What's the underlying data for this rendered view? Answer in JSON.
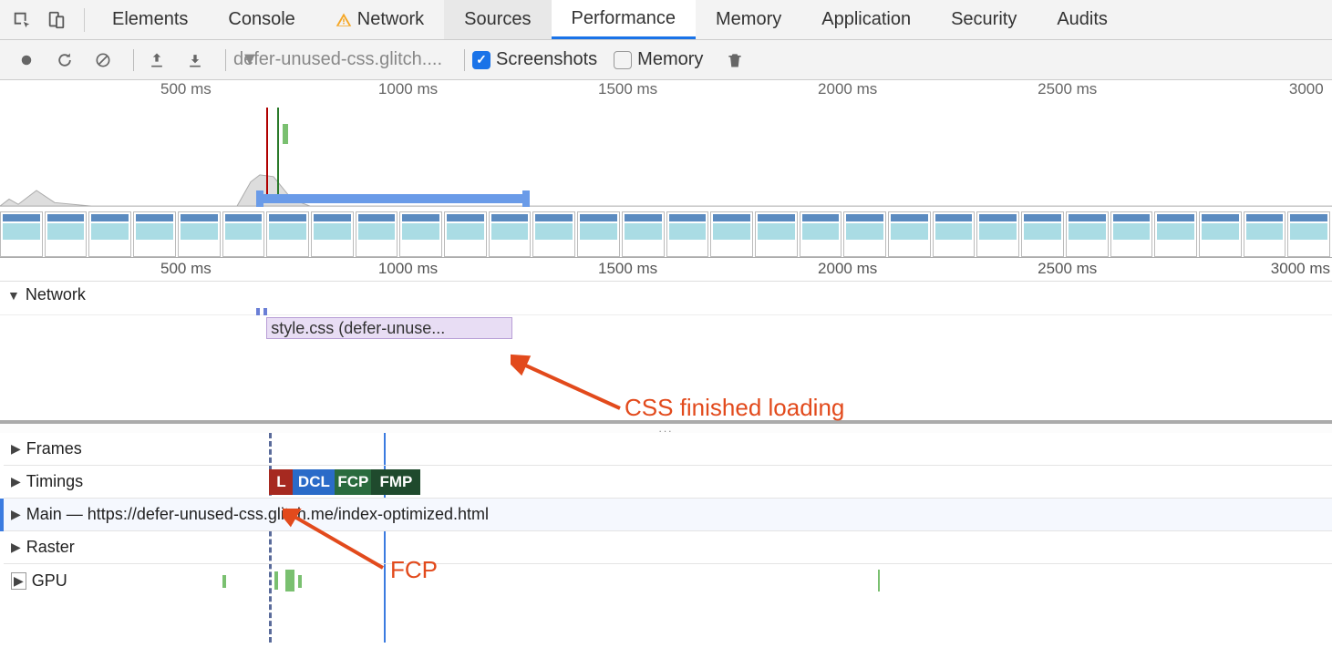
{
  "tabs": {
    "elements": "Elements",
    "console": "Console",
    "network": "Network",
    "sources": "Sources",
    "performance": "Performance",
    "memory": "Memory",
    "application": "Application",
    "security": "Security",
    "audits": "Audits"
  },
  "toolbar": {
    "dropdown_label": "defer-unused-css.glitch....",
    "screenshots_label": "Screenshots",
    "memory_label": "Memory",
    "screenshots_checked": true,
    "memory_checked": false
  },
  "overview_ticks": [
    "500 ms",
    "1000 ms",
    "1500 ms",
    "2000 ms",
    "2500 ms",
    "3000"
  ],
  "detail_ticks": [
    "500 ms",
    "1000 ms",
    "1500 ms",
    "2000 ms",
    "2500 ms",
    "3000 ms"
  ],
  "tracks": {
    "network": "Network",
    "frames": "Frames",
    "timings": "Timings",
    "main": "Main — https://defer-unused-css.glitch.me/index-optimized.html",
    "raster": "Raster",
    "gpu": "GPU"
  },
  "network_item": "style.css (defer-unuse...",
  "timings": {
    "l": "L",
    "dcl": "DCL",
    "fcp": "FCP",
    "fmp": "FMP"
  },
  "annotations": {
    "css_loaded": "CSS finished loading",
    "fcp": "FCP"
  }
}
